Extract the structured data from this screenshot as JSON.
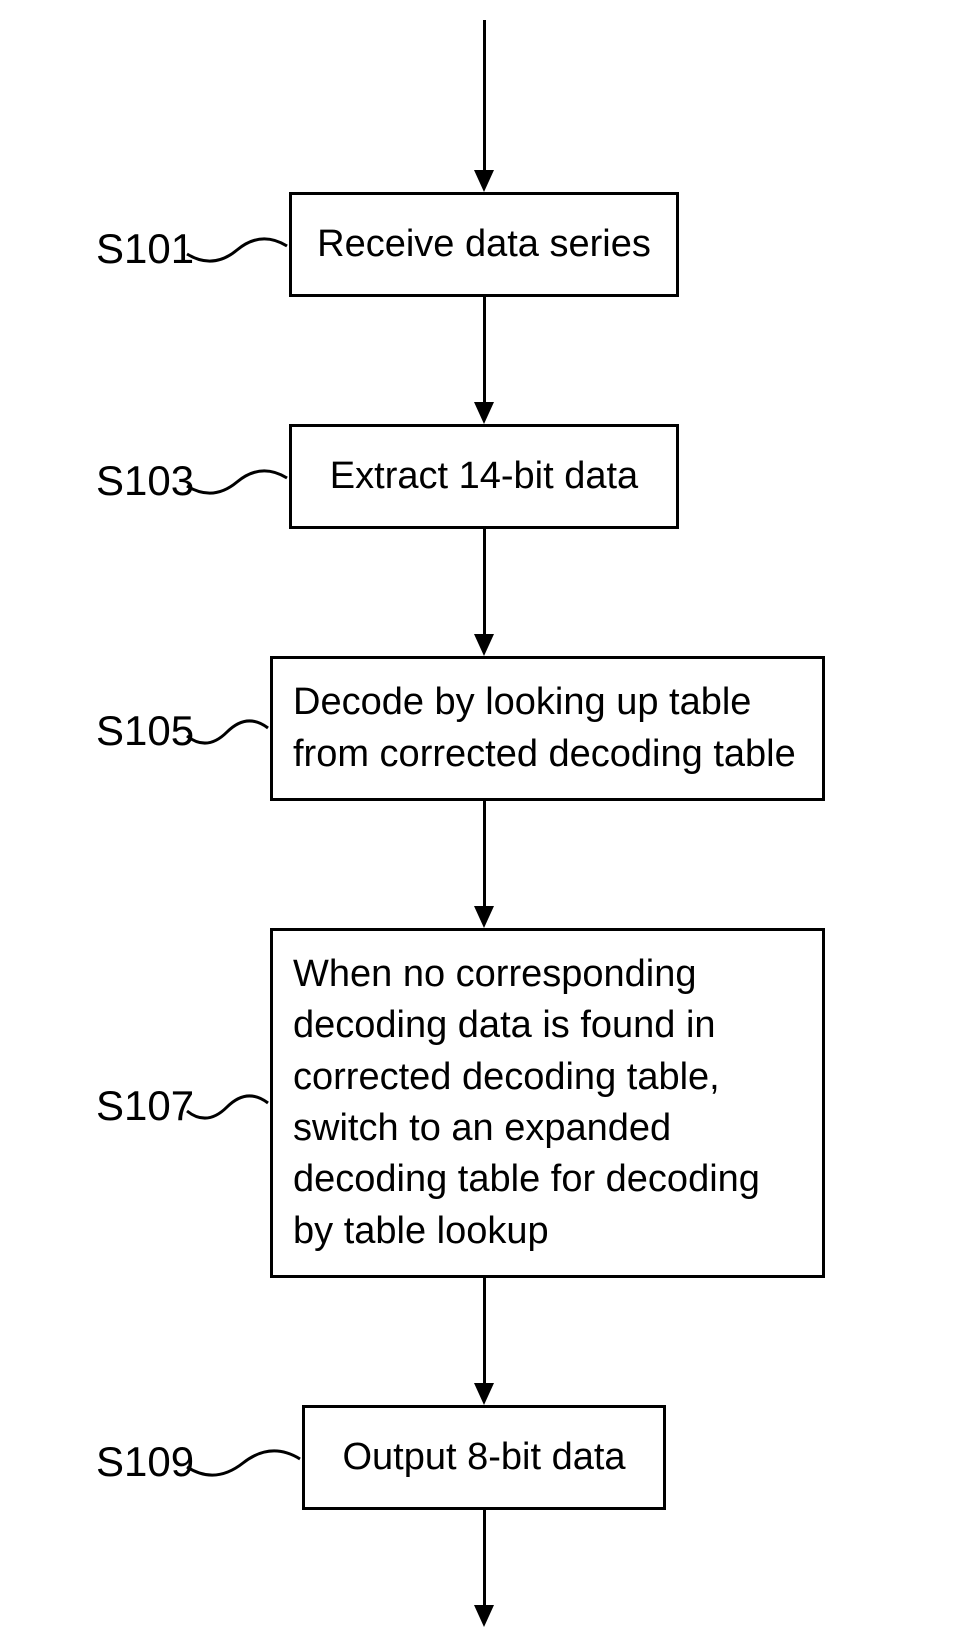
{
  "chart_data": {
    "type": "flowchart",
    "nodes": [
      {
        "id": "S101",
        "label": "Receive data series"
      },
      {
        "id": "S103",
        "label": "Extract 14-bit data"
      },
      {
        "id": "S105",
        "label": "Decode by looking up table from corrected decoding table"
      },
      {
        "id": "S107",
        "label": "When no corresponding decoding data is found in corrected decoding table, switch to an expanded decoding table for decoding by table lookup"
      },
      {
        "id": "S109",
        "label": "Output 8-bit data"
      }
    ],
    "edges": [
      {
        "from": "start",
        "to": "S101"
      },
      {
        "from": "S101",
        "to": "S103"
      },
      {
        "from": "S103",
        "to": "S105"
      },
      {
        "from": "S105",
        "to": "S107"
      },
      {
        "from": "S107",
        "to": "S109"
      },
      {
        "from": "S109",
        "to": "end"
      }
    ]
  },
  "labels": {
    "s101": "S101",
    "s103": "S103",
    "s105": "S105",
    "s107": "S107",
    "s109": "S109"
  },
  "steps": {
    "s101_text": "Receive data series",
    "s103_text": "Extract 14-bit data",
    "s105_text": "Decode by looking up table from corrected decoding table",
    "s107_text": "When no corresponding decoding data is found in corrected decoding table, switch to an expanded decoding table for decoding by table lookup",
    "s109_text": "Output 8-bit data"
  }
}
